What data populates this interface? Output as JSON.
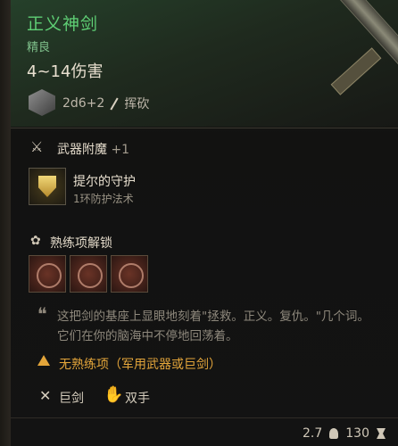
{
  "item": {
    "name": "正义神剑",
    "rarity": "精良",
    "damage": "4~14伤害",
    "dice_roll": "2d6+2",
    "damage_type": "挥砍",
    "icon": "dice-icon"
  },
  "enchantment": {
    "label": "武器附魔",
    "bonus": "+1"
  },
  "spell": {
    "name": "提尔的守护",
    "subtitle": "1环防护法术",
    "icon": "shield-icon"
  },
  "proficiency": {
    "title": "熟练项解锁",
    "skills": [
      "skill-icon-1",
      "skill-icon-2",
      "skill-icon-3"
    ]
  },
  "flavor": {
    "text": "这把剑的基座上显眼地刻着\"拯救。正义。复仇。\"几个词。它们在你的脑海中不停地回荡着。"
  },
  "warning": {
    "text": "无熟练项（军用武器或巨剑）"
  },
  "properties": [
    {
      "label": "巨剑",
      "icon": "crossed-swords-icon"
    },
    {
      "label": "双手",
      "icon": "hand-icon"
    }
  ],
  "footer": {
    "weight": "2.7",
    "value": "130"
  },
  "colors": {
    "title": "#5fcf75",
    "warning": "#e3a53a"
  }
}
